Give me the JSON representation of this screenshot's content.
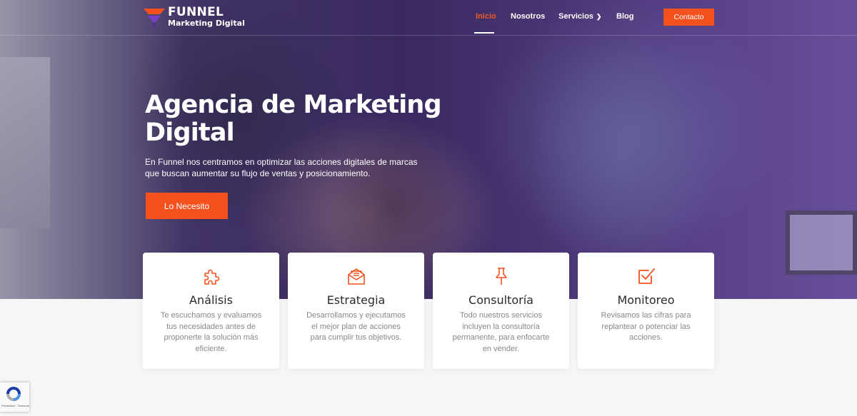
{
  "brand": {
    "name": "FUNNEL",
    "tagline": "Marketing Digital"
  },
  "nav": {
    "items": [
      {
        "label": "Inicio",
        "active": true
      },
      {
        "label": "Nosotros"
      },
      {
        "label": "Servicios",
        "has_dropdown": true
      },
      {
        "label": "Blog"
      }
    ],
    "contact_label": "Contacto"
  },
  "hero": {
    "title": "Agencia de Marketing Digital",
    "text": "En Funnel nos centramos en optimizar las acciones digitales de marcas que buscan aumentar su flujo de ventas y posicionamiento.",
    "cta_label": "Lo Necesito"
  },
  "cards": [
    {
      "icon": "puzzle-icon",
      "title": "Análisis",
      "text": "Te escuchamos y evaluamos tus necesidades antes de proponerte la solución más eficiente."
    },
    {
      "icon": "envelope-icon",
      "title": "Estrategia",
      "text": "Desarrollamos y ejecutamos el mejor plan de acciones para cumplir tus objetivos."
    },
    {
      "icon": "pushpin-icon",
      "title": "Consultoría",
      "text": "Todo nuestros servicios incluyen la consultoría permanente, para enfocarte en vender."
    },
    {
      "icon": "checkbox-icon",
      "title": "Monitoreo",
      "text": "Revisamos las cifras para replantear o potenciar las acciones."
    }
  ],
  "recaptcha": {
    "text": "Privacidad - Términos"
  },
  "colors": {
    "accent": "#f4511e",
    "hero_overlay": "#3d2d63",
    "card_title": "#2a2a2a",
    "card_text": "#888888"
  }
}
